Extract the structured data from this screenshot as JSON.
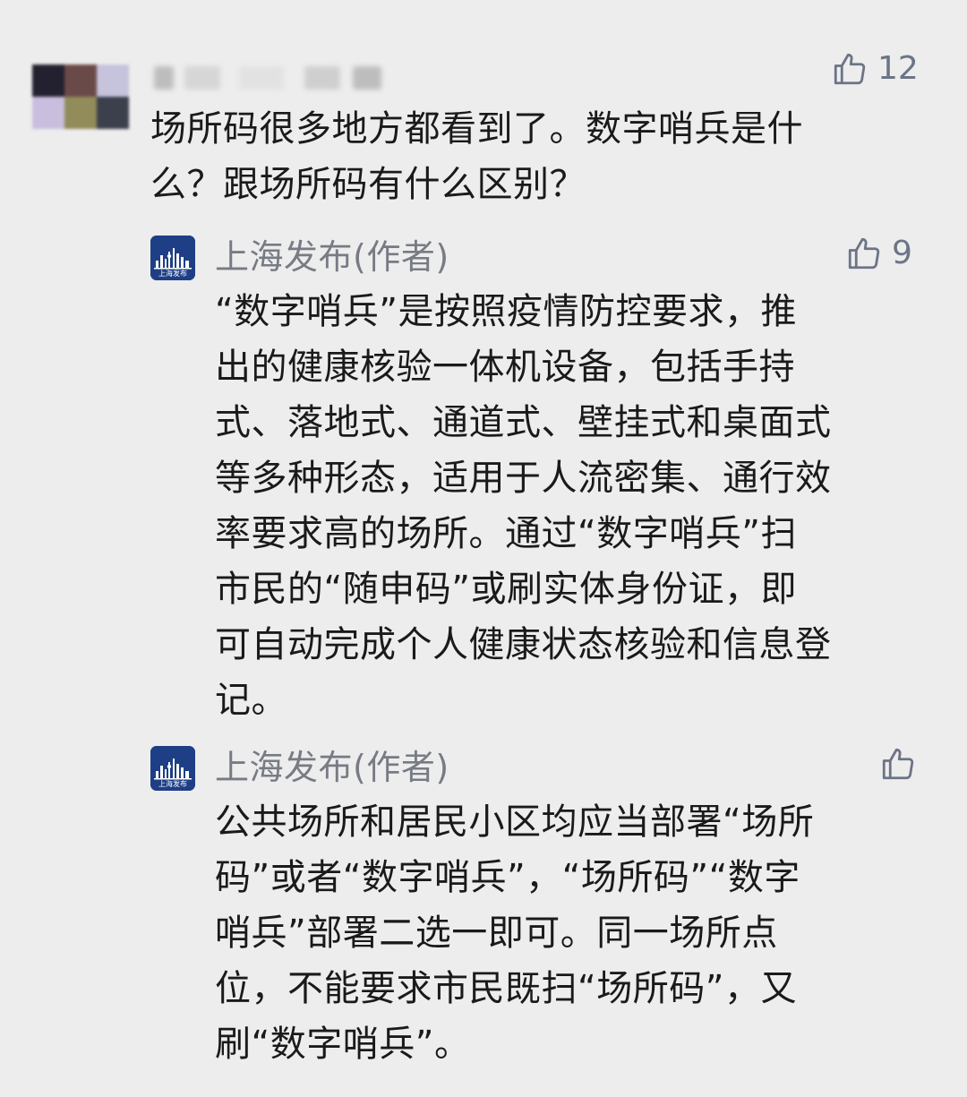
{
  "comment": {
    "likes": "12",
    "text": "场所码很多地方都看到了。数字哨兵是什\n么？跟场所码有什么区别？"
  },
  "replies": [
    {
      "author": "上海发布(作者)",
      "likes": "9",
      "text": "“数字哨兵”是按照疫情防控要求，推\n出的健康核验一体机设备，包括手持\n式、落地式、通道式、壁挂式和桌面式\n等多种形态，适用于人流密集、通行效\n率要求高的场所。通过“数字哨兵”扫\n市民的“随申码”或刷实体身份证，即\n可自动完成个人健康状态核验和信息登\n记。"
    },
    {
      "author": "上海发布(作者)",
      "likes": "",
      "text": "公共场所和居民小区均应当部署“场所\n码”或者“数字哨兵”，“场所码”“数字\n哨兵”部署二选一即可。同一场所点\n位，不能要求市民既扫“场所码”，又\n刷“数字哨兵”。"
    }
  ],
  "avatar_text": "上海发布",
  "icons": {
    "like": "thumbs-up-icon",
    "avatar": "shanghai-skyline-logo"
  },
  "colors": {
    "background": "#ededed",
    "text": "#1a1a1a",
    "meta": "#6c7486",
    "author_avatar": "#1e3f86"
  }
}
